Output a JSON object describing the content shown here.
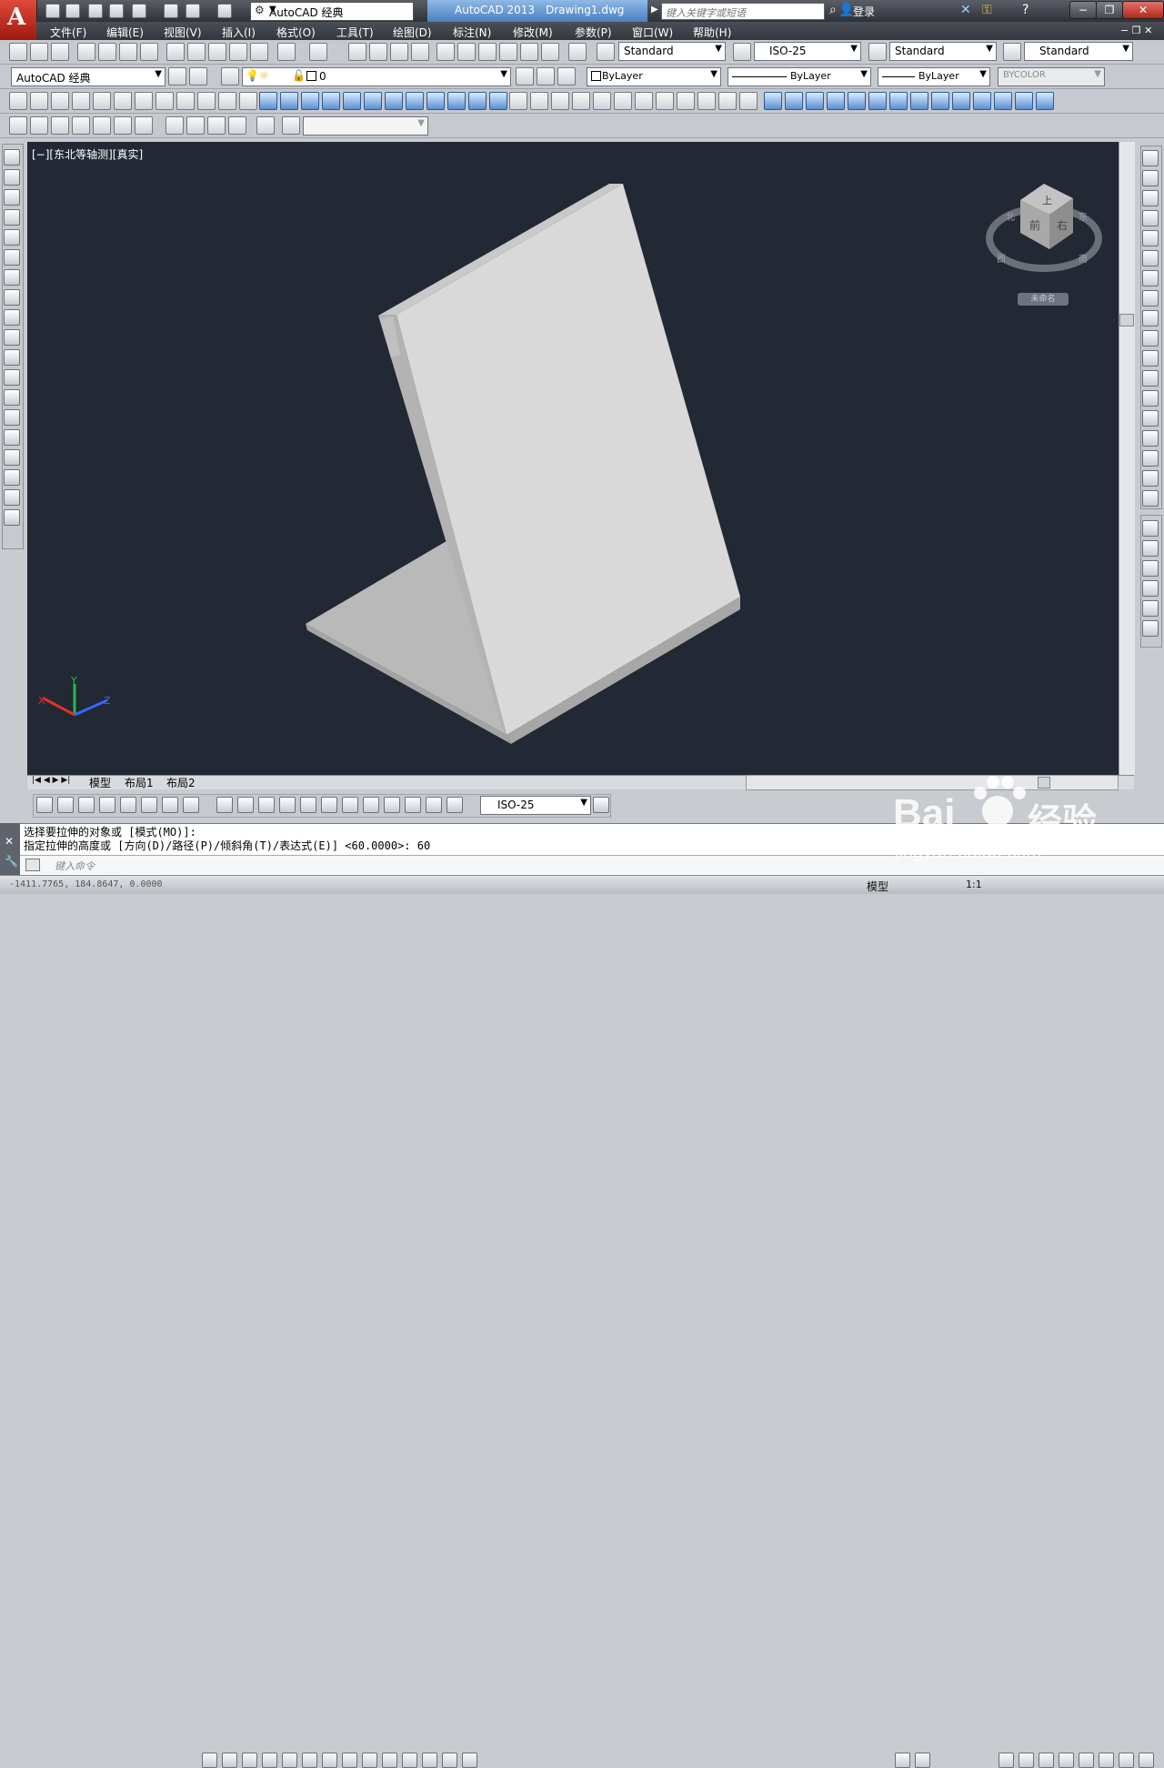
{
  "app": {
    "logo_letter": "A",
    "workspace": "AutoCAD 经典",
    "product": "AutoCAD 2013",
    "document": "Drawing1.dwg"
  },
  "search": {
    "placeholder": "键入关键字或短语"
  },
  "user": {
    "login": "登录"
  },
  "window_buttons": {
    "minimize": "−",
    "restore": "❐",
    "close": "✕"
  },
  "menu": [
    "文件(F)",
    "编辑(E)",
    "视图(V)",
    "插入(I)",
    "格式(O)",
    "工具(T)",
    "绘图(D)",
    "标注(N)",
    "修改(M)",
    "参数(P)",
    "窗口(W)",
    "帮助(H)"
  ],
  "styles": {
    "text_style": "Standard",
    "dim_style": "ISO-25",
    "table_style": "Standard",
    "mleader_style": "Standard"
  },
  "workspace_toolbar": {
    "workspace": "AutoCAD 经典"
  },
  "layer": {
    "current": "0"
  },
  "properties": {
    "color": "ByLayer",
    "linetype": "ByLayer",
    "lineweight": "ByLayer",
    "plotstyle": "BYCOLOR"
  },
  "viewport": {
    "label": "[−][东北等轴测][真实]",
    "viewcube": {
      "face_top": "上",
      "face_front": "前",
      "face_right": "右",
      "compass_n": "北",
      "compass_e": "东",
      "compass_s": "南",
      "compass_w": "西",
      "wcs_menu": "未命名"
    },
    "ucs": {
      "x": "X",
      "y": "Y",
      "z": "Z"
    },
    "colors": {
      "background": "#222834",
      "solid_light": "#d9d9d9",
      "solid_mid": "#b8b8b8",
      "solid_dark": "#a3a3a3"
    }
  },
  "layout_tabs": [
    "模型",
    "布局1",
    "布局2"
  ],
  "dim_toolbar": {
    "dim_style": "ISO-25"
  },
  "command": {
    "history": [
      "选择要拉伸的对象或 [模式(MO)]:",
      "指定拉伸的高度或 [方向(D)/路径(P)/倾斜角(T)/表达式(E)] <60.0000>: 60"
    ],
    "prompt_placeholder": "键入命令"
  },
  "status": {
    "coords": "-1411.7765, 184.8647, 0.0000",
    "space": "模型",
    "scale": "1:1"
  },
  "watermark": {
    "brand": "Bai",
    "brand2": "经验",
    "url": "jingyan.baidu.com"
  }
}
